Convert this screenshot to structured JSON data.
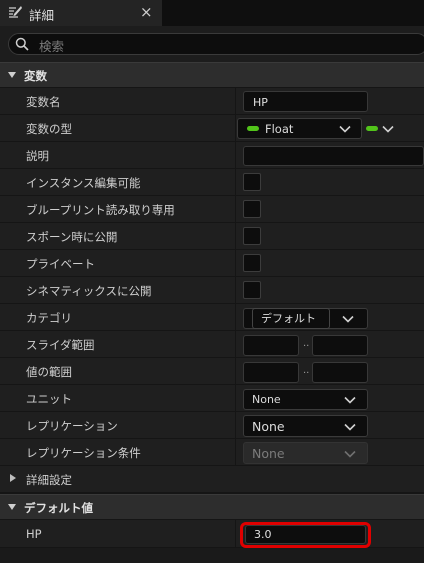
{
  "tab": {
    "title": "詳細",
    "close": "×"
  },
  "search": {
    "placeholder": "検索"
  },
  "sections": {
    "variables": "変数",
    "defaults": "デフォルト値"
  },
  "rows": {
    "var_name": {
      "label": "変数名",
      "value": "HP"
    },
    "var_type": {
      "label": "変数の型",
      "value": "Float"
    },
    "description": {
      "label": "説明"
    },
    "instance_editable": {
      "label": "インスタンス編集可能"
    },
    "blueprint_readonly": {
      "label": "ブループリント読み取り専用"
    },
    "expose_spawn": {
      "label": "スポーン時に公開"
    },
    "private": {
      "label": "プライベート"
    },
    "expose_cinematics": {
      "label": "シネマティックスに公開"
    },
    "category": {
      "label": "カテゴリ",
      "value": "デフォルト"
    },
    "slider_range": {
      "label": "スライダ範囲",
      "separator": ".."
    },
    "value_range": {
      "label": "値の範囲",
      "separator": ".."
    },
    "units": {
      "label": "ユニット",
      "value": "None"
    },
    "replication": {
      "label": "レプリケーション",
      "value": "None"
    },
    "replication_cond": {
      "label": "レプリケーション条件",
      "value": "None"
    },
    "advanced": {
      "label": "詳細設定"
    },
    "default_hp": {
      "label": "HP",
      "value": "3.0"
    }
  },
  "colors": {
    "type_pill": "#52c41a",
    "highlight": "#e00000"
  },
  "icons": {
    "tab": "pencil-table-icon",
    "search": "search-icon",
    "dropdown": "chevron-down-icon"
  }
}
